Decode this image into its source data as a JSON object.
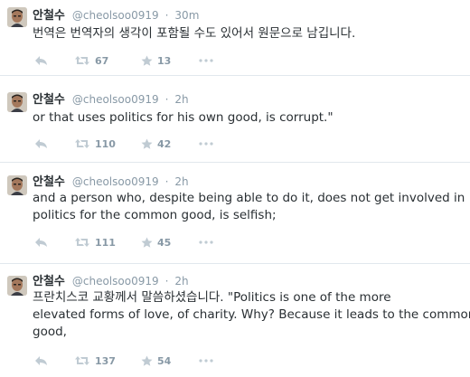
{
  "tweets": [
    {
      "name": "안철수",
      "handle": "@cheolsoo0919",
      "separator": "·",
      "time": "30m",
      "lines": [
        "번역은 번역자의 생각이 포함될 수도 있어서 원문으로 남깁니다."
      ],
      "retweets": "67",
      "favorites": "13"
    },
    {
      "name": "안철수",
      "handle": "@cheolsoo0919",
      "separator": "·",
      "time": "2h",
      "lines": [
        "or that uses politics for his own good, is corrupt.\""
      ],
      "retweets": "110",
      "favorites": "42"
    },
    {
      "name": "안철수",
      "handle": "@cheolsoo0919",
      "separator": "·",
      "time": "2h",
      "lines": [
        "and a person who, despite being able to do it, does not get involved in",
        "politics for the common good, is selfish;"
      ],
      "retweets": "111",
      "favorites": "45"
    },
    {
      "name": "안철수",
      "handle": "@cheolsoo0919",
      "separator": "·",
      "time": "2h",
      "lines": [
        "프란치스코 교황께서 말씀하셨습니다. \"Politics is one of the more",
        "elevated forms of love, of charity. Why? Because it leads to the common",
        "good,"
      ],
      "retweets": "137",
      "favorites": "54"
    }
  ],
  "icons": {
    "reply": "reply-icon",
    "retweet": "retweet-icon",
    "favorite": "star-icon",
    "more": "more-icon"
  },
  "colors": {
    "icon_gray": "#c0cbd3",
    "text_dark": "#292f33",
    "meta_gray": "#8899a6",
    "divider": "#e1e8ed"
  }
}
